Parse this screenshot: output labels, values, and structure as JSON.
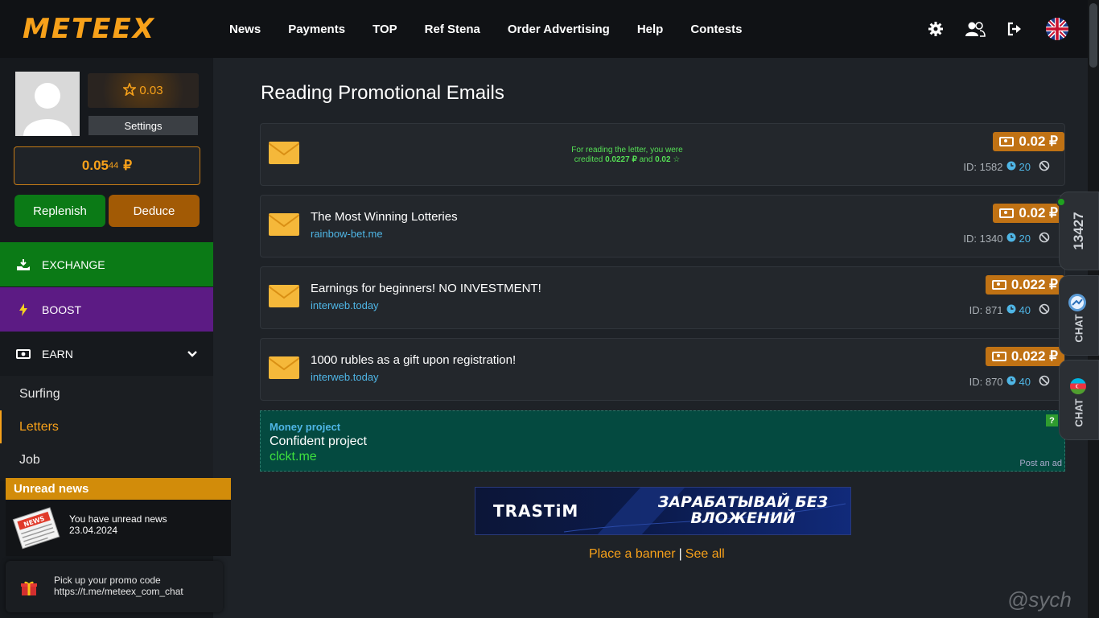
{
  "header": {
    "logo": "METEEX",
    "nav": [
      "News",
      "Payments",
      "TOP",
      "Ref Stena",
      "Order Advertising",
      "Help",
      "Contests"
    ],
    "icons": [
      "gear-icon",
      "users-icon",
      "logout-icon",
      "uk-flag-icon"
    ]
  },
  "profile": {
    "rating": "0.03",
    "settings_label": "Settings",
    "balance_main": "0.05",
    "balance_small": "44",
    "currency": "₽",
    "replenish_label": "Replenish",
    "deduce_label": "Deduce"
  },
  "menu": {
    "exchange": "EXCHANGE",
    "boost": "BOOST",
    "earn": "EARN",
    "submenu": [
      "Surfing",
      "Letters",
      "Job"
    ],
    "active": "Letters"
  },
  "news": {
    "header": "Unread news",
    "text": "You have unread news",
    "date": "23.04.2024"
  },
  "promo": {
    "line1": "Pick up your promo code",
    "line2": "https://t.me/meteex_com_chat"
  },
  "main": {
    "title": "Reading Promotional Emails",
    "credited_line1": "For reading the letter, you were",
    "credited_prefix": "credited",
    "credited_amount": "0.0227 ₽",
    "credited_and": "and",
    "credited_rating": "0.02",
    "mails": [
      {
        "title": "",
        "link": "",
        "price": "0.02 ₽",
        "id": "ID: 1582",
        "count": "20"
      },
      {
        "title": "The Most Winning Lotteries",
        "link": "rainbow-bet.me",
        "price": "0.02 ₽",
        "id": "ID: 1340",
        "count": "20"
      },
      {
        "title": "Earnings for beginners! NO INVESTMENT!",
        "link": "interweb.today",
        "price": "0.022 ₽",
        "id": "ID: 871",
        "count": "40"
      },
      {
        "title": "1000 rubles as a gift upon registration!",
        "link": "interweb.today",
        "price": "0.022 ₽",
        "id": "ID: 870",
        "count": "40"
      }
    ]
  },
  "ad": {
    "label": "Money project",
    "text": "Confident project",
    "link": "clckt.me",
    "help": "?",
    "post": "Post an ad"
  },
  "banner": {
    "logo": "TRASTiM",
    "slogan": "ЗАРАБАТЫВАЙ БЕЗ ВЛОЖЕНИЙ",
    "place": "Place a banner",
    "sep": "|",
    "see_all": "See all"
  },
  "side_tabs": {
    "online": "13427",
    "chat1": "CHAT",
    "chat2": "CHAT"
  },
  "watermark": "@sych",
  "colors": {
    "accent": "#f7a11a",
    "green": "#0b7a16",
    "purple": "#5c1b84",
    "link": "#4fb6e6"
  }
}
